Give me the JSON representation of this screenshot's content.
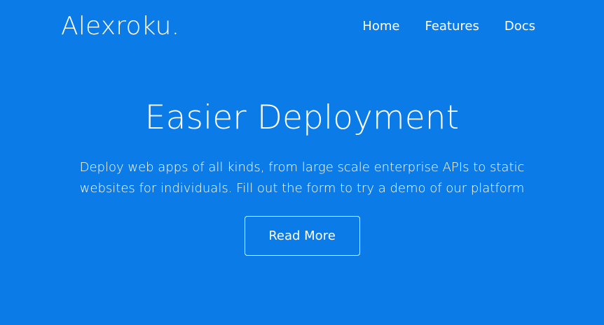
{
  "brand": {
    "name": "Alexroku."
  },
  "nav": {
    "items": [
      {
        "label": "Home"
      },
      {
        "label": "Features"
      },
      {
        "label": "Docs"
      }
    ]
  },
  "hero": {
    "title": "Easier Deployment",
    "description": "Deploy web apps of all kinds, from large scale enterprise APIs to static websites for individuals. Fill out the form to try a demo of our platform",
    "button_label": "Read More"
  },
  "colors": {
    "background": "#0b7be8",
    "text": "#ffffff"
  }
}
